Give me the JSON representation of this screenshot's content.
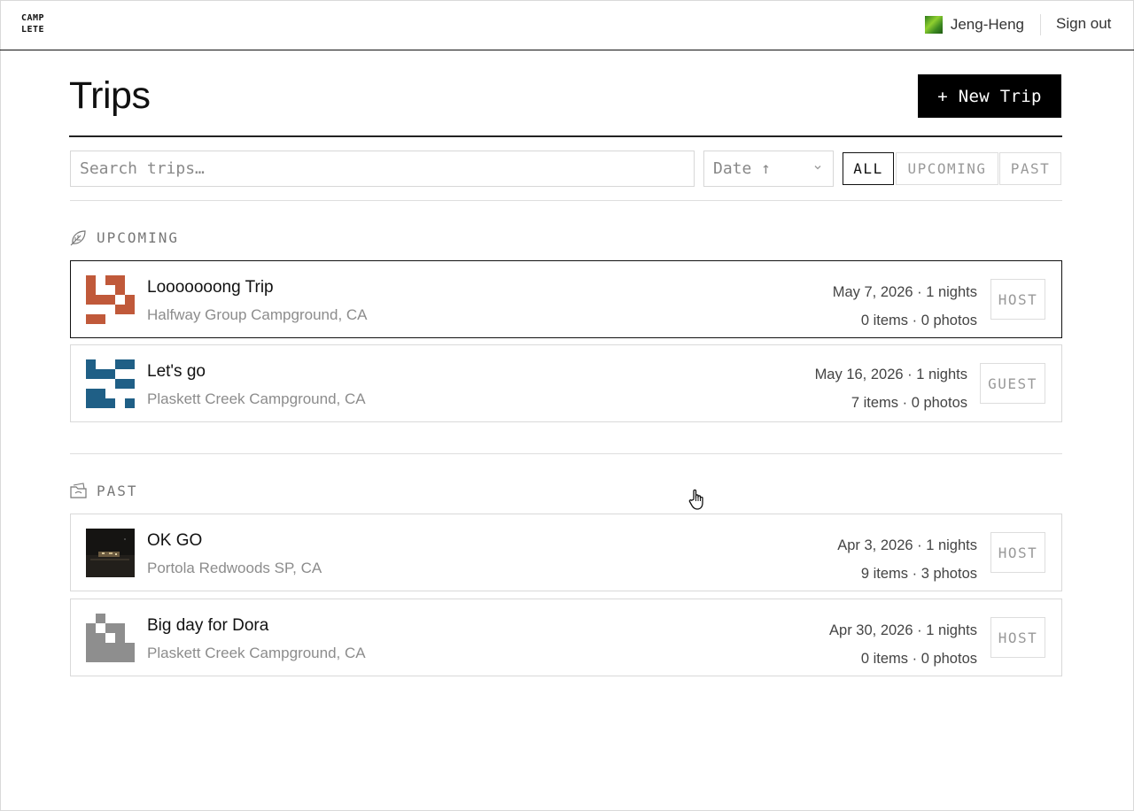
{
  "header": {
    "logo_line1": "CAMP",
    "logo_line2": "LETE",
    "user_name": "Jeng-Heng",
    "sign_out": "Sign out"
  },
  "page": {
    "title": "Trips",
    "new_trip_label": "+ New Trip"
  },
  "toolbar": {
    "search_placeholder": "Search trips…",
    "search_value": "",
    "sort_value": "Date ↑",
    "filters": [
      {
        "label": "ALL",
        "active": true
      },
      {
        "label": "UPCOMING",
        "active": false
      },
      {
        "label": "PAST",
        "active": false
      }
    ]
  },
  "sections": {
    "upcoming": {
      "heading": "UPCOMING",
      "icon": "leaf-icon",
      "trips": [
        {
          "name": "Looooooong Trip",
          "location": "Halfway Group Campground, CA",
          "date_nights": "May 7, 2026 · 1 nights",
          "counts": "0 items · 0 photos",
          "role": "HOST",
          "thumb_color": "#c0593a"
        },
        {
          "name": "Let's go",
          "location": "Plaskett Creek Campground, CA",
          "date_nights": "May 16, 2026 · 1 nights",
          "counts": "7 items · 0 photos",
          "role": "GUEST",
          "thumb_color": "#1f5f86"
        }
      ]
    },
    "past": {
      "heading": "PAST",
      "icon": "folder-icon",
      "trips": [
        {
          "name": "OK GO",
          "location": "Portola Redwoods SP, CA",
          "date_nights": "Apr 3, 2026 · 1 nights",
          "counts": "9 items · 3 photos",
          "role": "HOST",
          "thumb_color": "#1a1a1a"
        },
        {
          "name": "Big day for Dora",
          "location": "Plaskett Creek Campground, CA",
          "date_nights": "Apr 30, 2026 · 1 nights",
          "counts": "0 items · 0 photos",
          "role": "HOST",
          "thumb_color": "#8e8e8e"
        }
      ]
    }
  },
  "colors": {
    "accent": "#000000",
    "border": "#d9d9d9",
    "muted_text": "#8c8c8c"
  }
}
